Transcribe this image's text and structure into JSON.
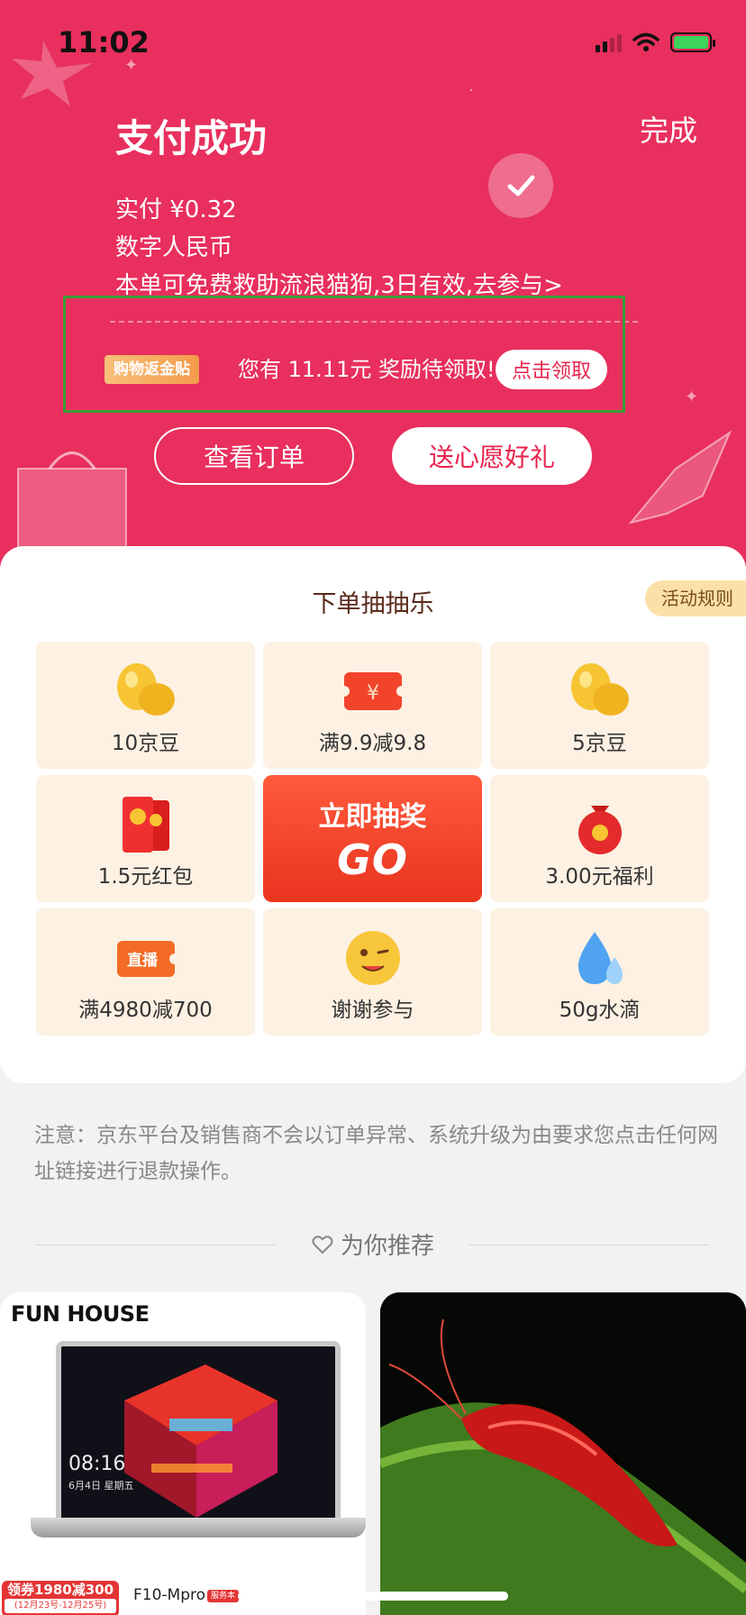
{
  "status_bar": {
    "time": "11:02"
  },
  "header": {
    "title": "支付成功",
    "done_label": "完成",
    "paid_line": "实付 ¥0.32",
    "payment_method": "数字人民币",
    "charity_line": "本单可免费救助流浪猫狗,3日有效,去参与>",
    "rebate_tag": "购物返金贴",
    "rebate_text": "您有 11.11元 奖励待领取!",
    "claim_label": "点击领取",
    "view_order_label": "查看订单",
    "gift_label": "送心愿好礼",
    "highlight_color": "#3a9e3a",
    "accent_color": "#e82f5d"
  },
  "lottery": {
    "title": "下单抽抽乐",
    "rules_label": "活动规则",
    "prizes": [
      {
        "label": "10京豆",
        "icon": "bean-icon"
      },
      {
        "label": "满9.9减9.8",
        "icon": "coupon-icon"
      },
      {
        "label": "5京豆",
        "icon": "bean-icon"
      },
      {
        "label": "1.5元红包",
        "icon": "red-envelope-icon"
      },
      {
        "label": "3.00元福利",
        "icon": "money-bag-icon"
      },
      {
        "label": "满4980减700",
        "icon": "live-ticket-icon"
      },
      {
        "label": "谢谢参与",
        "icon": "wink-face-icon"
      },
      {
        "label": "50g水滴",
        "icon": "water-drop-icon"
      }
    ],
    "go_top": "立即抽奖",
    "go_big": "GO"
  },
  "notice": "注意：京东平台及销售商不会以订单异常、系统升级为由要求您点击任何网址链接进行退款操作。",
  "recommend": {
    "title": "为你推荐",
    "products": [
      {
        "brand": "FUN HOUSE",
        "screen_time": "08:16",
        "screen_date": "6月4日 星期五",
        "coupon_main": "领券1980减300",
        "coupon_sub": "(12月23号-12月25号)",
        "model": "F10-Mpro",
        "model_badge": "服务本"
      },
      {
        "image": "red-shrimp-photo"
      }
    ]
  }
}
